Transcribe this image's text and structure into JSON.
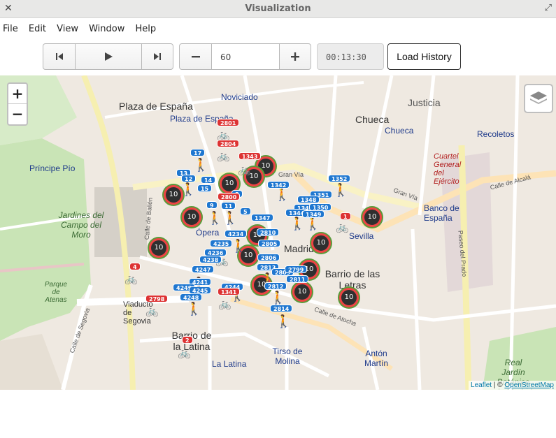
{
  "window": {
    "title": "Visualization",
    "close_icon": "close-icon",
    "maximize_icon": "maximize-icon"
  },
  "menu": [
    "File",
    "Edit",
    "View",
    "Window",
    "Help"
  ],
  "toolbar": {
    "speed_value": "60",
    "time_value": "00:13:30",
    "load_label": "Load History"
  },
  "map": {
    "zoom_in": "+",
    "zoom_out": "−",
    "attribution_leaflet": "Leaflet",
    "attribution_sep": " | © ",
    "attribution_osm": "OpenStreetMap",
    "places": [
      "Plaza de España",
      "Plaza de España",
      "Noviciado",
      "Justicia",
      "Chueca",
      "Chueca",
      "Recoletos",
      "Príncipe Pío",
      "Jardines del Campo del Moro",
      "Ópera",
      "Madrid",
      "Sevilla",
      "Banco de España",
      "Barrio de las Letras",
      "Barrio de la Latina",
      "La Latina",
      "Tirso de Molina",
      "Antón Martín",
      "Cuartel General del Ejército",
      "Real Jardín Botánico de Madrid",
      "Parque de Atenas",
      "Viaducto de Segovia"
    ],
    "streets": [
      "Gran Vía",
      "Gran Vía",
      "Calle de Alcalá",
      "Calle de Atocha",
      "Calle de Segovia",
      "Paseo del Prado",
      "Calle de Bailén"
    ]
  },
  "markers": {
    "clusters": [
      "10",
      "10",
      "10",
      "10",
      "10",
      "10",
      "10",
      "10",
      "10",
      "10",
      "10",
      "10",
      "10",
      "10"
    ],
    "badges_blue": [
      "17",
      "13",
      "12",
      "14",
      "15",
      "9",
      "11",
      "8",
      "5",
      "1347",
      "1342",
      "1352",
      "1351",
      "1348",
      "1345",
      "1350",
      "1344",
      "1349",
      "4234",
      "2810",
      "4235",
      "2805",
      "4236",
      "4238",
      "2806",
      "4247",
      "2813",
      "2809",
      "2799",
      "4241",
      "2811",
      "4249",
      "4244",
      "4245",
      "2812",
      "4248",
      "2814"
    ],
    "badges_red": [
      "2801",
      "2804",
      "1343",
      "2800",
      "1",
      "4",
      "2798",
      "1341",
      "2"
    ]
  },
  "colors": {
    "badge_blue": "#1f77d0",
    "badge_red": "#dd3333",
    "cluster_ring": "#e44444",
    "cluster_outer": "#5b9b3b"
  }
}
